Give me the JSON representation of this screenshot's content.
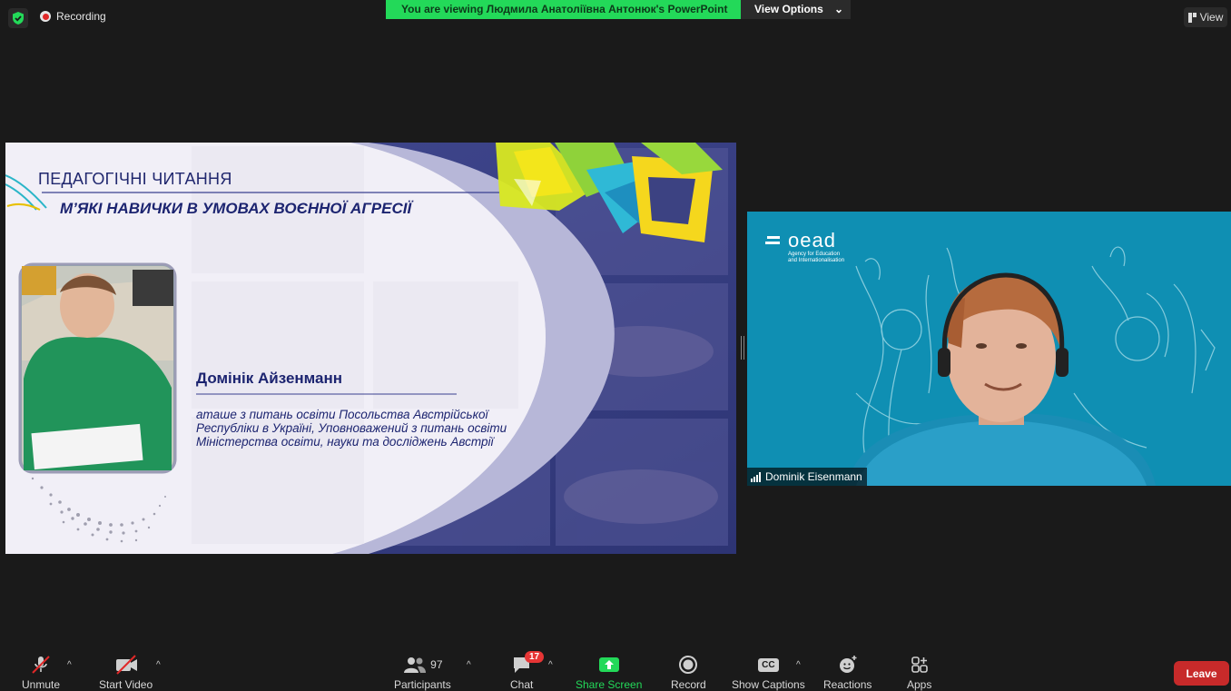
{
  "topbar": {
    "recording_label": "Recording",
    "share_banner": "You are viewing Людмила Анатоліївна Антонюк's PowerPoint",
    "view_options_label": "View Options",
    "view_label": "View"
  },
  "slide": {
    "title_top": "ПЕДАГОГІЧНІ ЧИТАННЯ",
    "title_main": "М’ЯКІ НАВИЧКИ В УМОВАХ ВОЄННОЇ АГРЕСІЇ",
    "speaker_name": "Домінік Айзенманн",
    "speaker_desc_1": "аташе з питань освіти Посольства Австрійської",
    "speaker_desc_2": "Республіки в Україні, Уповноважений з питань освіти",
    "speaker_desc_3": "Міністерства освіти, науки та досліджень Австрії"
  },
  "camera": {
    "participant_name": "Dominik Eisenmann",
    "logo_text": "OeAD",
    "logo_sub_1": "Agency for Education",
    "logo_sub_2": "and Internationalisation"
  },
  "toolbar": {
    "unmute_label": "Unmute",
    "start_video_label": "Start Video",
    "participants_label": "Participants",
    "participants_count": "97",
    "chat_label": "Chat",
    "chat_badge": "17",
    "share_label": "Share Screen",
    "record_label": "Record",
    "captions_label": "Show Captions",
    "captions_icon_text": "CC",
    "reactions_label": "Reactions",
    "apps_label": "Apps",
    "leave_label": "Leave"
  },
  "colors": {
    "banner_green": "#23d959",
    "leave_red": "#c72a2a",
    "share_green": "#23d959",
    "camera_bg": "#0f8fb3",
    "slide_navy": "#1c2470"
  }
}
